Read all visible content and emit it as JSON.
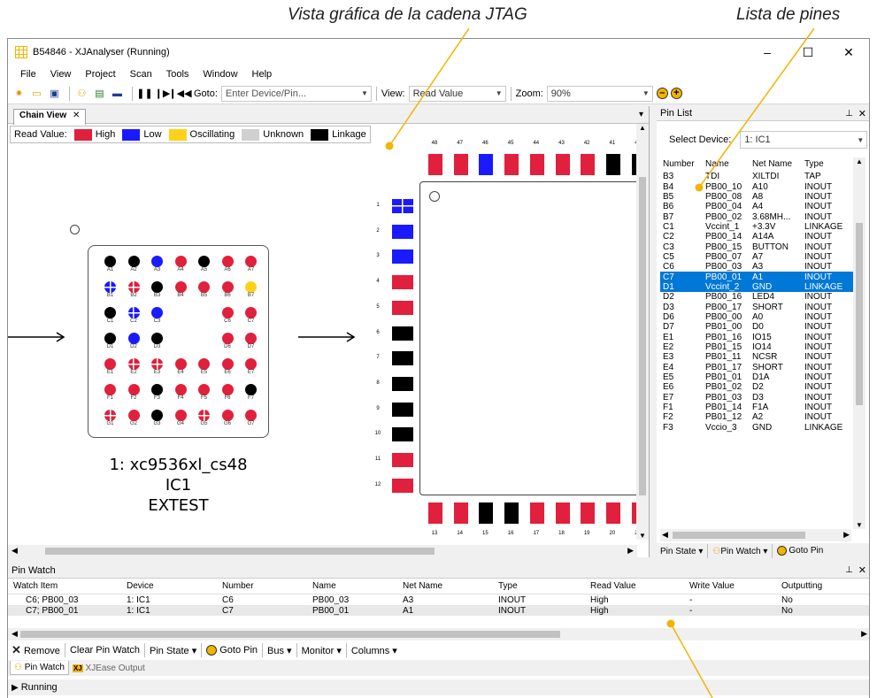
{
  "annotations": {
    "chain_view": "Vista gráfica de la cadena JTAG",
    "pin_list": "Lista de pines"
  },
  "window": {
    "title": "B54846 - XJAnalyser (Running)",
    "minimize": "–",
    "maximize": "☐",
    "close": "✕"
  },
  "menu": [
    "File",
    "View",
    "Project",
    "Scan",
    "Tools",
    "Window",
    "Help"
  ],
  "toolbar": {
    "goto_label": "Goto:",
    "goto_placeholder": "Enter Device/Pin...",
    "view_label": "View:",
    "view_value": "Read Value",
    "zoom_label": "Zoom:",
    "zoom_value": "90%"
  },
  "chain_view": {
    "tab": "Chain View",
    "close": "✕",
    "pin_button": "▾",
    "legend": {
      "title": "Read Value:",
      "items": [
        {
          "label": "High",
          "color": "#e0203c"
        },
        {
          "label": "Low",
          "color": "#1a1aff"
        },
        {
          "label": "Oscillating",
          "color": "#ffd21a"
        },
        {
          "label": "Unknown",
          "color": "#d0d0d0"
        },
        {
          "label": "Linkage",
          "color": "#000000"
        }
      ]
    },
    "device1": {
      "name": "1: xc9536xl_cs48",
      "id": "IC1",
      "mode": "EXTEST",
      "rows": [
        [
          "A",
          "black",
          "black",
          "blue",
          "red",
          "black",
          "red",
          "red"
        ],
        [
          "B",
          "bluecross",
          "redcross",
          "black",
          "red",
          "red",
          "red",
          "yellow"
        ],
        [
          "C",
          "black",
          "bluecross",
          "blue",
          "",
          "",
          "red",
          "red"
        ],
        [
          "D",
          "black",
          "blue",
          "black",
          "",
          "",
          "red",
          "red"
        ],
        [
          "E",
          "red",
          "redcross",
          "redcross",
          "red",
          "red",
          "red",
          "red"
        ],
        [
          "F",
          "red",
          "red",
          "black",
          "red",
          "red",
          "red",
          "black"
        ],
        [
          "G",
          "redcross",
          "red",
          "black",
          "red",
          "redcross",
          "red",
          "red"
        ]
      ]
    },
    "device2": {
      "top_pins": [
        "48",
        "47",
        "46",
        "45",
        "44",
        "43",
        "42",
        "41",
        "40"
      ],
      "top_colors": [
        "red",
        "red",
        "blue",
        "red",
        "red",
        "red",
        "red",
        "black",
        "black"
      ],
      "left_pins": [
        "1",
        "2",
        "3",
        "4",
        "5",
        "6",
        "7",
        "8",
        "9",
        "10",
        "11",
        "12"
      ],
      "left_colors": [
        "bluegrid",
        "blue",
        "blue",
        "red",
        "red",
        "black",
        "black",
        "black",
        "black",
        "black",
        "red",
        "red"
      ],
      "bottom_pins": [
        "13",
        "14",
        "15",
        "16",
        "17",
        "18",
        "19",
        "20",
        "21"
      ],
      "bottom_colors": [
        "red",
        "red",
        "black",
        "black",
        "red",
        "red",
        "red",
        "red",
        "red"
      ]
    }
  },
  "pin_list": {
    "title": "Pin List",
    "select_label": "Select Device:",
    "device": "1: IC1",
    "headers": [
      "Number",
      "Name",
      "Net Name",
      "Type"
    ],
    "rows": [
      [
        "B3",
        "TDI",
        "XILTDI",
        "TAP"
      ],
      [
        "B4",
        "PB00_10",
        "A10",
        "INOUT"
      ],
      [
        "B5",
        "PB00_08",
        "A8",
        "INOUT"
      ],
      [
        "B6",
        "PB00_04",
        "A4",
        "INOUT"
      ],
      [
        "B7",
        "PB00_02",
        "3.68MH...",
        "INOUT"
      ],
      [
        "C1",
        "Vccint_1",
        "+3.3V",
        "LINKAGE"
      ],
      [
        "C2",
        "PB00_14",
        "A14A",
        "INOUT"
      ],
      [
        "C3",
        "PB00_15",
        "BUTTON",
        "INOUT"
      ],
      [
        "C5",
        "PB00_07",
        "A7",
        "INOUT"
      ],
      [
        "C6",
        "PB00_03",
        "A3",
        "INOUT"
      ],
      [
        "C7",
        "PB00_01",
        "A1",
        "INOUT"
      ],
      [
        "D1",
        "Vccint_2",
        "GND",
        "LINKAGE"
      ],
      [
        "D2",
        "PB00_16",
        "LED4",
        "INOUT"
      ],
      [
        "D3",
        "PB00_17",
        "SHORT",
        "INOUT"
      ],
      [
        "D6",
        "PB00_00",
        "A0",
        "INOUT"
      ],
      [
        "D7",
        "PB01_00",
        "D0",
        "INOUT"
      ],
      [
        "E1",
        "PB01_16",
        "IO15",
        "INOUT"
      ],
      [
        "E2",
        "PB01_15",
        "IO14",
        "INOUT"
      ],
      [
        "E3",
        "PB01_11",
        "NCSR",
        "INOUT"
      ],
      [
        "E4",
        "PB01_17",
        "SHORT",
        "INOUT"
      ],
      [
        "E5",
        "PB01_01",
        "D1A",
        "INOUT"
      ],
      [
        "E6",
        "PB01_02",
        "D2",
        "INOUT"
      ],
      [
        "E7",
        "PB01_03",
        "D3",
        "INOUT"
      ],
      [
        "F1",
        "PB01_14",
        "F1A",
        "INOUT"
      ],
      [
        "F2",
        "PB01_12",
        "A2",
        "INOUT"
      ],
      [
        "F3",
        "Vccio_3",
        "GND",
        "LINKAGE"
      ]
    ],
    "selected": [
      10,
      11
    ],
    "footer": {
      "pin_state": "Pin State",
      "pin_watch": "Pin Watch",
      "goto_pin": "Goto Pin"
    }
  },
  "pin_watch": {
    "title": "Pin Watch",
    "headers": [
      "Watch Item",
      "Device",
      "Number",
      "Name",
      "Net Name",
      "Type",
      "Read Value",
      "Write Value",
      "Outputting"
    ],
    "rows": [
      [
        "C6; PB00_03",
        "1: IC1",
        "C6",
        "PB00_03",
        "A3",
        "INOUT",
        "High",
        "-",
        "No"
      ],
      [
        "C7; PB00_01",
        "1: IC1",
        "C7",
        "PB00_01",
        "A1",
        "INOUT",
        "High",
        "-",
        "No"
      ]
    ],
    "toolbar": {
      "remove": "Remove",
      "clear": "Clear Pin Watch",
      "pin_state": "Pin State",
      "goto_pin": "Goto Pin",
      "bus": "Bus",
      "monitor": "Monitor",
      "columns": "Columns"
    },
    "tabs": {
      "pin_watch": "Pin Watch",
      "xjease": "XJEase Output"
    }
  },
  "status": {
    "text": "Running"
  }
}
